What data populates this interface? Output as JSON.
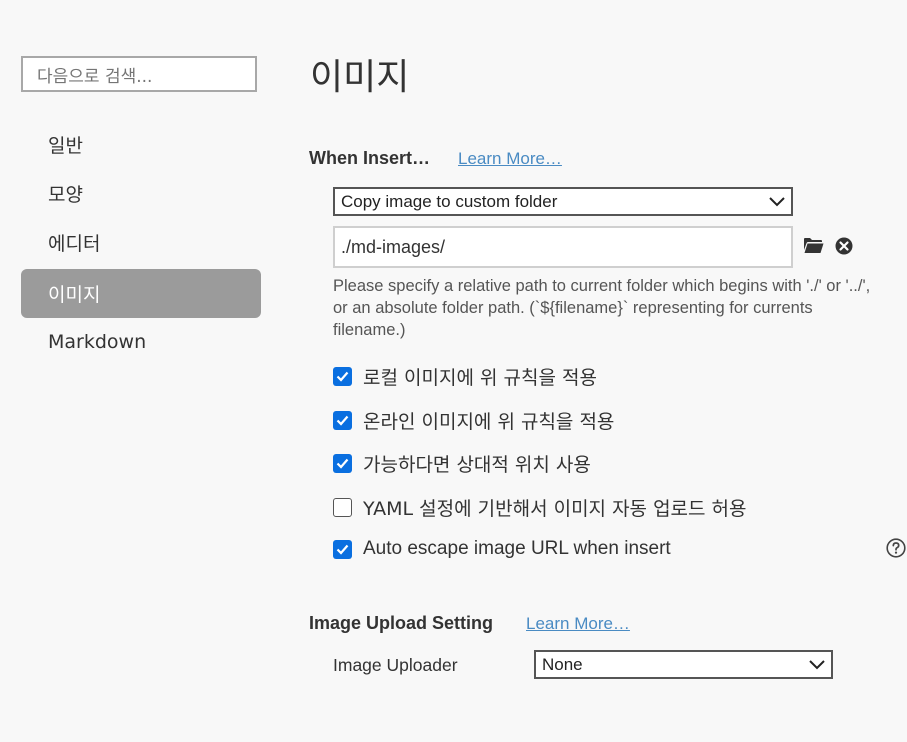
{
  "sidebar": {
    "search_placeholder": "다음으로 검색...",
    "items": [
      {
        "label": "일반"
      },
      {
        "label": "모양"
      },
      {
        "label": "에디터"
      },
      {
        "label": "이미지",
        "active": true
      },
      {
        "label": "Markdown"
      }
    ]
  },
  "main": {
    "title": "이미지",
    "when_insert": {
      "heading": "When Insert…",
      "learn_more": "Learn More…",
      "action_select": "Copy image to custom folder",
      "path_value": "./md-images/",
      "help": "Please specify a relative path to current folder which begins with './' or '../', or an absolute folder path. (`${filename}` representing for currents filename.)"
    },
    "options": [
      {
        "label": "로컬 이미지에 위 규칙을 적용",
        "checked": true
      },
      {
        "label": "온라인 이미지에 위 규칙을 적용",
        "checked": true
      },
      {
        "label": "가능하다면 상대적 위치 사용",
        "checked": true
      },
      {
        "label": "YAML 설정에 기반해서 이미지 자동 업로드 허용",
        "checked": false
      },
      {
        "label": "Auto escape image URL when insert",
        "checked": true
      }
    ],
    "upload": {
      "heading": "Image Upload Setting",
      "learn_more": "Learn More…",
      "uploader_label": "Image Uploader",
      "uploader_value": "None"
    }
  },
  "colors": {
    "accent": "#0a6fe0",
    "link": "#4a8bc3",
    "active_nav": "#9b9b9b"
  }
}
